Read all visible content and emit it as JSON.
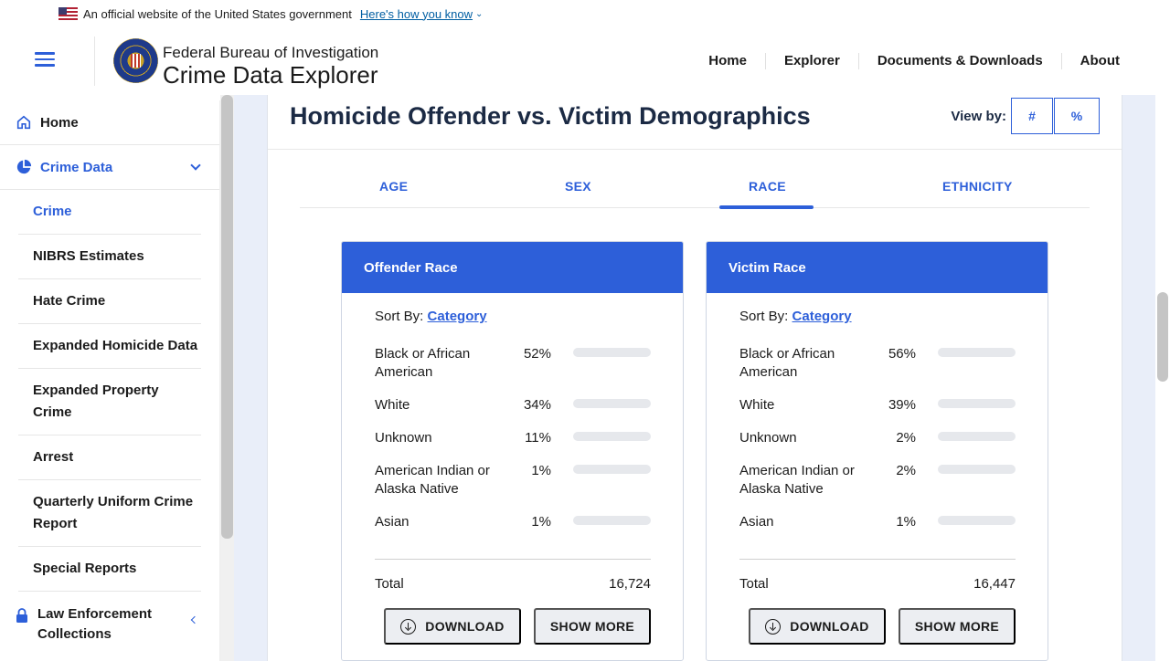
{
  "gov_banner": {
    "text": "An official website of the United States government",
    "link": "Here's how you know"
  },
  "header": {
    "brand_line1": "Federal Bureau of Investigation",
    "brand_line2": "Crime Data Explorer",
    "nav": [
      "Home",
      "Explorer",
      "Documents & Downloads",
      "About"
    ]
  },
  "sidebar": {
    "home": "Home",
    "crime_data": "Crime Data",
    "items": [
      "Crime",
      "NIBRS Estimates",
      "Hate Crime",
      "Expanded Homicide Data",
      "Expanded Property Crime",
      "Arrest",
      "Quarterly Uniform Crime Report",
      "Special Reports"
    ],
    "law_enforcement": "Law Enforcement Collections"
  },
  "main": {
    "title": "Homicide Offender vs. Victim Demographics",
    "view_by_label": "View by:",
    "view_by_options": [
      "#",
      "%"
    ],
    "tabs": [
      "AGE",
      "SEX",
      "RACE",
      "ETHNICITY"
    ],
    "active_tab": "RACE",
    "sort_by_label": "Sort By:",
    "sort_by_value": "Category",
    "total_label": "Total",
    "download_label": "DOWNLOAD",
    "show_more_label": "SHOW MORE",
    "accent_color": "#2d5fd9",
    "bar_color": "#2d7ff0"
  },
  "panels": [
    {
      "title": "Offender Race",
      "total": "16,724",
      "rows": [
        {
          "category": "Black or African American",
          "percent_label": "52%",
          "percent": 52
        },
        {
          "category": "White",
          "percent_label": "34%",
          "percent": 34
        },
        {
          "category": "Unknown",
          "percent_label": "11%",
          "percent": 11
        },
        {
          "category": "American Indian or Alaska Native",
          "percent_label": "1%",
          "percent": 1
        },
        {
          "category": "Asian",
          "percent_label": "1%",
          "percent": 1
        }
      ]
    },
    {
      "title": "Victim Race",
      "total": "16,447",
      "rows": [
        {
          "category": "Black or African American",
          "percent_label": "56%",
          "percent": 56
        },
        {
          "category": "White",
          "percent_label": "39%",
          "percent": 39
        },
        {
          "category": "Unknown",
          "percent_label": "2%",
          "percent": 2
        },
        {
          "category": "American Indian or Alaska Native",
          "percent_label": "2%",
          "percent": 2
        },
        {
          "category": "Asian",
          "percent_label": "1%",
          "percent": 1
        }
      ]
    }
  ]
}
